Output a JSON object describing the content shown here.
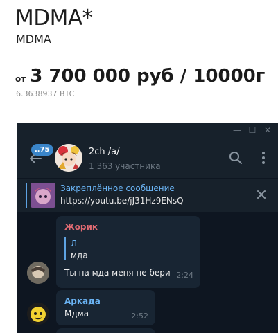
{
  "product": {
    "title": "MDMA*",
    "subtitle": "MDMA",
    "price_prefix": "от",
    "price": "3 700 000 руб / 10000г",
    "price_btc": "6.3638937 BTC"
  },
  "telegram": {
    "window_buttons": {
      "minimize": "—",
      "maximize": "☐",
      "close": "✕"
    },
    "header": {
      "back_icon": "arrow-left-icon",
      "unread_count": "..75",
      "chat_name": "2ch /a/",
      "members": "1 363 участника"
    },
    "pinned": {
      "title": "Закреплённое сообщение",
      "text": "https://youtu.be/jJ31Hz9ENsQ"
    },
    "messages": [
      {
        "sender": "Жорик",
        "reply_name": "Л",
        "reply_text": "мда",
        "text": "Ты на мда меня не бери",
        "time": "2:24"
      },
      {
        "sender": "Аркада",
        "text": "Мдма",
        "time": "2:52"
      }
    ],
    "colors": {
      "background": "#0e1621",
      "panel": "#17212b",
      "bubble": "#182533",
      "accent": "#6ab3f3",
      "sender_red": "#e16b73"
    }
  }
}
